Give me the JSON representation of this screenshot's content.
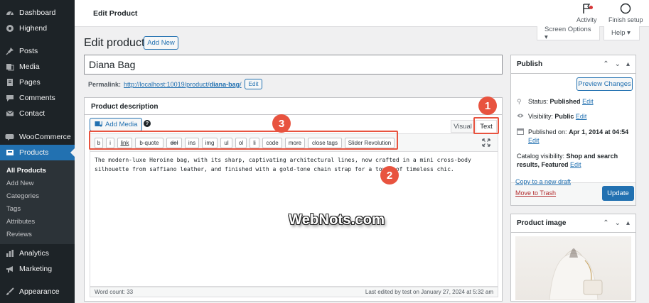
{
  "sidebar": {
    "items": [
      {
        "label": "Dashboard",
        "icon": "dashboard-icon"
      },
      {
        "label": "Highend",
        "icon": "highend-icon"
      },
      {
        "label": "Posts",
        "icon": "pin-icon"
      },
      {
        "label": "Media",
        "icon": "media-icon"
      },
      {
        "label": "Pages",
        "icon": "pages-icon"
      },
      {
        "label": "Comments",
        "icon": "comment-icon"
      },
      {
        "label": "Contact",
        "icon": "mail-icon"
      },
      {
        "label": "WooCommerce",
        "icon": "woo-icon"
      },
      {
        "label": "Products",
        "icon": "products-icon"
      },
      {
        "label": "Analytics",
        "icon": "analytics-icon"
      },
      {
        "label": "Marketing",
        "icon": "megaphone-icon"
      },
      {
        "label": "Appearance",
        "icon": "brush-icon"
      }
    ],
    "submenu": [
      "All Products",
      "Add New",
      "Categories",
      "Tags",
      "Attributes",
      "Reviews"
    ]
  },
  "header": {
    "title": "Edit Product",
    "activity": "Activity",
    "finish_setup": "Finish setup",
    "screen_options": "Screen Options ▾",
    "help": "Help ▾"
  },
  "page": {
    "heading": "Edit product",
    "add_new": "Add New",
    "title_value": "Diana Bag",
    "permalink_label": "Permalink:",
    "permalink_base": "http://localhost:10019/product/",
    "permalink_slug": "diana-bag",
    "permalink_trail": "/",
    "permalink_edit": "Edit"
  },
  "description": {
    "heading": "Product description",
    "add_media": "Add Media",
    "help_glyph": "?",
    "tab_visual": "Visual",
    "tab_text": "Text",
    "quicktags": [
      "b",
      "i",
      "link",
      "b-quote",
      "del",
      "ins",
      "img",
      "ul",
      "ol",
      "li",
      "code",
      "more",
      "close tags",
      "Slider Revolution"
    ],
    "content": "The modern-luxe Heroine bag, with its sharp, captivating architectural lines, now crafted in a mini cross-body silhouette from saffiano leather, and finished with a gold-tone chain strap for a touch of timeless chic.",
    "word_count": "Word count: 33",
    "last_edited": "Last edited by test on January 27, 2024 at 5:32 am"
  },
  "annotations": {
    "badge_1": "1",
    "badge_2": "2",
    "badge_3": "3",
    "color": "#e8533f"
  },
  "watermark": "WebNots.com",
  "publish": {
    "heading": "Publish",
    "preview": "Preview Changes",
    "status_label": "Status:",
    "status_value": "Published",
    "visibility_label": "Visibility:",
    "visibility_value": "Public",
    "published_label": "Published on:",
    "published_value": "Apr 1, 2014 at 04:54",
    "catalog_label": "Catalog visibility:",
    "catalog_value": "Shop and search results, Featured",
    "edit": "Edit",
    "copy_draft": "Copy to a new draft",
    "trash": "Move to Trash",
    "update": "Update"
  },
  "product_image": {
    "heading": "Product image"
  },
  "colors": {
    "sidebar_bg": "#1d2327",
    "accent": "#2271b1",
    "trash": "#b32d2e"
  }
}
